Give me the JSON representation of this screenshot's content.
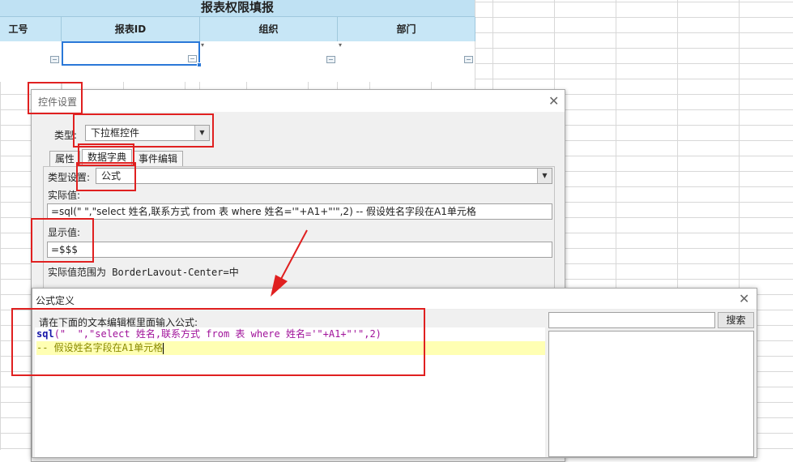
{
  "spreadsheet": {
    "title": "报表权限填报",
    "headers": [
      "工号",
      "报表ID",
      "组织",
      "部门"
    ]
  },
  "control_dialog": {
    "title": "控件设置",
    "type_label": "类型:",
    "type_value": "下拉框控件",
    "tabs": [
      "属性",
      "数据字典",
      "事件编辑"
    ],
    "type_setting_label": "类型设置:",
    "type_setting_value": "公式",
    "actual_value_label": "实际值:",
    "actual_value": "=sql(\" \",\"select 姓名,联系方式 from 表 where 姓名='\"+A1+\"'\",2) -- 假设姓名字段在A1单元格",
    "display_value_label": "显示值:",
    "display_value": "=$$$",
    "range_note": "实际值范围为 BorderLavout-Center=中"
  },
  "formula_dialog": {
    "title": "公式定义",
    "prompt": "请在下面的文本编辑框里面输入公式:",
    "code_line1": {
      "fn": "sql",
      "args": "(\"  \",\"select 姓名,联系方式 from 表 where 姓名='\"+A1+\"'\",2)"
    },
    "code_line2": "-- 假设姓名字段在A1单元格",
    "search_button": "搜索",
    "search_value": ""
  },
  "colors": {
    "header_bg": "#c7e6f6",
    "annotation": "#e02020",
    "selection": "#2a78d8"
  }
}
